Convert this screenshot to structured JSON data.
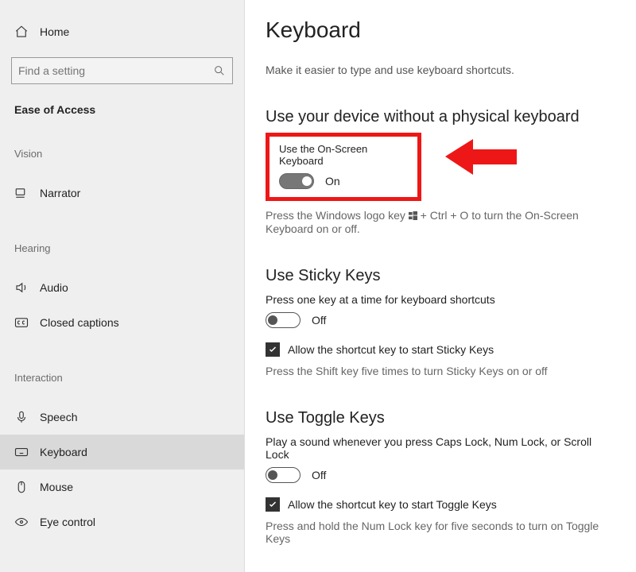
{
  "home": {
    "label": "Home"
  },
  "search": {
    "placeholder": "Find a setting"
  },
  "sidebar": {
    "category": "Ease of Access",
    "groups": [
      {
        "label": "Vision",
        "items": [
          {
            "label": "Narrator",
            "icon": "narrator"
          }
        ]
      },
      {
        "label": "Hearing",
        "items": [
          {
            "label": "Audio",
            "icon": "audio"
          },
          {
            "label": "Closed captions",
            "icon": "cc"
          }
        ]
      },
      {
        "label": "Interaction",
        "items": [
          {
            "label": "Speech",
            "icon": "mic"
          },
          {
            "label": "Keyboard",
            "icon": "keyboard",
            "selected": true
          },
          {
            "label": "Mouse",
            "icon": "mouse"
          },
          {
            "label": "Eye control",
            "icon": "eye"
          }
        ]
      }
    ]
  },
  "page": {
    "title": "Keyboard",
    "subtitle": "Make it easier to type and use keyboard shortcuts."
  },
  "osk": {
    "section_title": "Use your device without a physical keyboard",
    "toggle_label": "Use the On-Screen Keyboard",
    "toggle_state": "On",
    "hint_before": "Press the Windows logo key ",
    "hint_after": " + Ctrl + O to turn the On-Screen Keyboard on or off."
  },
  "sticky": {
    "section_title": "Use Sticky Keys",
    "desc": "Press one key at a time for keyboard shortcuts",
    "toggle_state": "Off",
    "checkbox_label": "Allow the shortcut key to start Sticky Keys",
    "hint": "Press the Shift key five times to turn Sticky Keys on or off"
  },
  "togglekeys": {
    "section_title": "Use Toggle Keys",
    "desc": "Play a sound whenever you press Caps Lock, Num Lock, or Scroll Lock",
    "toggle_state": "Off",
    "checkbox_label": "Allow the shortcut key to start Toggle Keys",
    "hint": "Press and hold the Num Lock key for five seconds to turn on Toggle Keys"
  }
}
